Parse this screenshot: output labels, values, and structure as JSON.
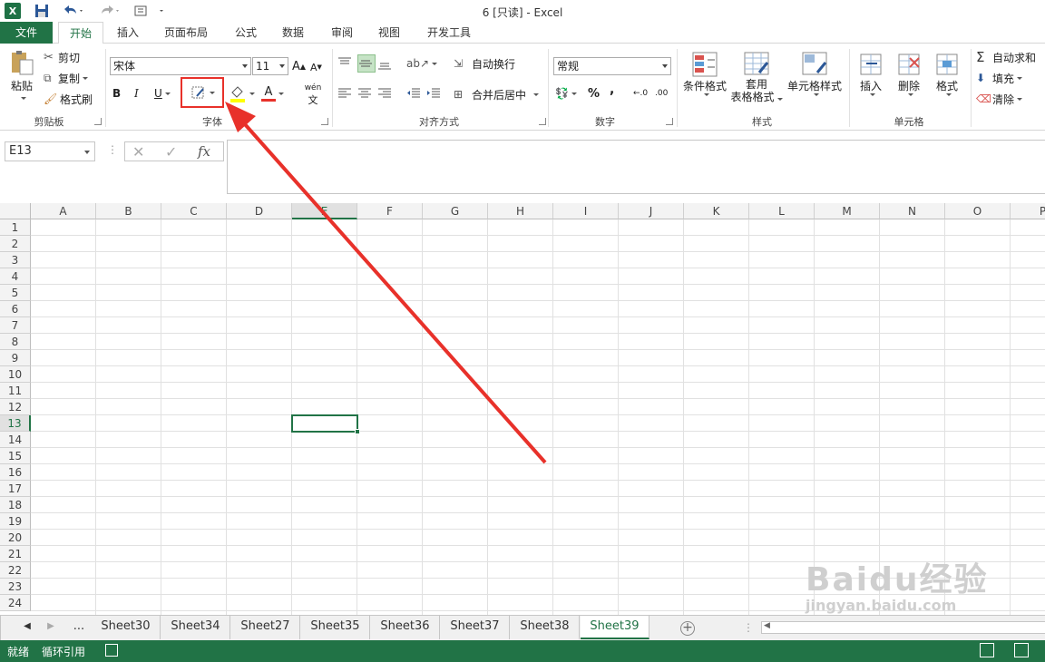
{
  "window": {
    "title": "6  [只读] - Excel"
  },
  "tabs": [
    "文件",
    "开始",
    "插入",
    "页面布局",
    "公式",
    "数据",
    "审阅",
    "视图",
    "开发工具"
  ],
  "ribbon": {
    "clipboard": {
      "paste": "粘贴",
      "cut": "剪切",
      "copy": "复制",
      "format_painter": "格式刷",
      "label": "剪贴板"
    },
    "font": {
      "name": "宋体",
      "size": "11",
      "bold": "B",
      "italic": "I",
      "underline": "U",
      "font_color": "A",
      "increase": "A",
      "decrease": "A",
      "phonetic": "wén",
      "label": "字体"
    },
    "alignment": {
      "wrap_text": "自动换行",
      "merge_center": "合并后居中",
      "label": "对齐方式"
    },
    "number": {
      "format": "常规",
      "percent": "%",
      "comma": ",",
      "inc_dec": "←.0",
      "dec_dec": ".00",
      "label": "数字"
    },
    "styles": {
      "conditional": "条件格式",
      "table_format_1": "套用",
      "table_format_2": "表格格式",
      "cell_styles": "单元格样式",
      "label": "样式"
    },
    "cells": {
      "insert": "插入",
      "delete": "删除",
      "format": "格式",
      "label": "单元格"
    },
    "editing": {
      "autosum": "自动求和",
      "fill": "填充",
      "clear": "清除"
    }
  },
  "formula_bar": {
    "name_box": "E13",
    "fx": "fx",
    "value": ""
  },
  "grid": {
    "columns": [
      "A",
      "B",
      "C",
      "D",
      "E",
      "F",
      "G",
      "H",
      "I",
      "J",
      "K",
      "L",
      "M",
      "N",
      "O",
      "P"
    ],
    "rows": [
      "1",
      "2",
      "3",
      "4",
      "5",
      "6",
      "7",
      "8",
      "9",
      "10",
      "11",
      "12",
      "13",
      "14",
      "15",
      "16",
      "17",
      "18",
      "19",
      "20",
      "21",
      "22",
      "23",
      "24"
    ],
    "selected_column": "E",
    "selected_row": "13"
  },
  "sheets": {
    "ellipsis": "...",
    "tabs": [
      "Sheet30",
      "Sheet34",
      "Sheet27",
      "Sheet35",
      "Sheet36",
      "Sheet37",
      "Sheet38",
      "Sheet39"
    ],
    "active": "Sheet39",
    "add": "+"
  },
  "status": {
    "ready": "就绪",
    "circular": "循环引用"
  },
  "watermark": {
    "brand": "Baidu经验",
    "url": "jingyan.baidu.com"
  },
  "colors": {
    "excel_green": "#217346",
    "annotation_red": "#e8312a"
  }
}
